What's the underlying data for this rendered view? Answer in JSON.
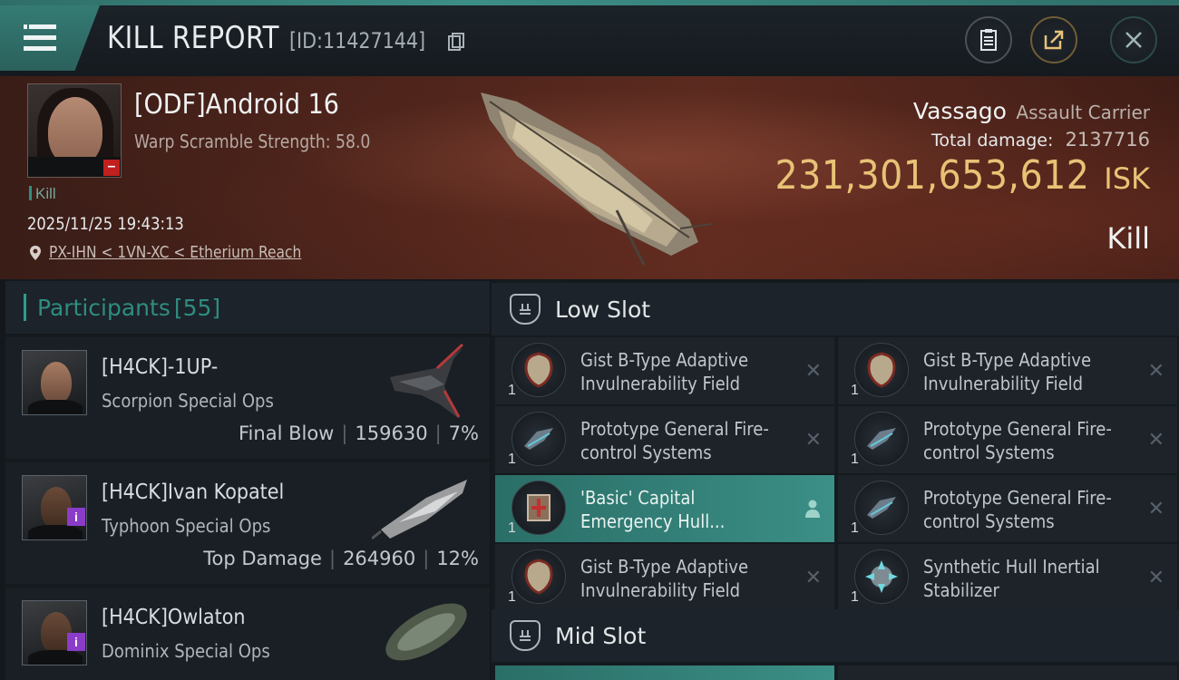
{
  "header": {
    "title": "KILL REPORT",
    "report_id": "[ID:11427144]",
    "accent": "#357b74"
  },
  "victim": {
    "name": "[ODF]Android 16",
    "warp_scramble": "Warp Scramble Strength: 58.0",
    "tag": "Kill",
    "timestamp": "2025/11/25 19:43:13",
    "location": "PX-IHN < 1VN-XC < Etherium Reach",
    "ship_name": "Vassago",
    "ship_class": "Assault Carrier",
    "damage_label": "Total damage:",
    "damage_value": "2137716",
    "isk_value": "231,301,653,612",
    "isk_unit": "ISK",
    "result": "Kill",
    "isk_color": "#e8c275"
  },
  "participants": {
    "label": "Participants",
    "count": "[55]",
    "rows": [
      {
        "name": "[H4CK]-1UP-",
        "ship": "Scorpion Special Ops",
        "role": "Final Blow",
        "damage": "159630",
        "percent": "7%",
        "badge": ""
      },
      {
        "name": "[H4CK]Ivan Kopatel",
        "ship": "Typhoon Special Ops",
        "role": "Top Damage",
        "damage": "264960",
        "percent": "12%",
        "badge": "i"
      },
      {
        "name": "[H4CK]Owlaton",
        "ship": "Dominix Special Ops",
        "badge": "i"
      }
    ]
  },
  "fitting": {
    "low_slot_label": "Low Slot",
    "mid_slot_label": "Mid Slot",
    "low_slot": [
      {
        "name": "Gist B-Type Adaptive Invulnerability Field",
        "qty": "1",
        "icon": "shield-module-icon"
      },
      {
        "name": "Gist B-Type Adaptive Invulnerability Field",
        "qty": "1",
        "icon": "shield-module-icon"
      },
      {
        "name": "Prototype General Fire-control Systems",
        "qty": "1",
        "icon": "fire-control-icon"
      },
      {
        "name": "Prototype General Fire-control Systems",
        "qty": "1",
        "icon": "fire-control-icon"
      },
      {
        "name": "'Basic' Capital Emergency Hull...",
        "qty": "1",
        "icon": "hull-module-icon",
        "highlighted": true
      },
      {
        "name": "Prototype General Fire-control Systems",
        "qty": "1",
        "icon": "fire-control-icon"
      },
      {
        "name": "Gist B-Type Adaptive Invulnerability Field",
        "qty": "1",
        "icon": "shield-module-icon"
      },
      {
        "name": "Synthetic Hull Inertial Stabilizer",
        "qty": "1",
        "icon": "stabilizer-icon"
      }
    ]
  }
}
